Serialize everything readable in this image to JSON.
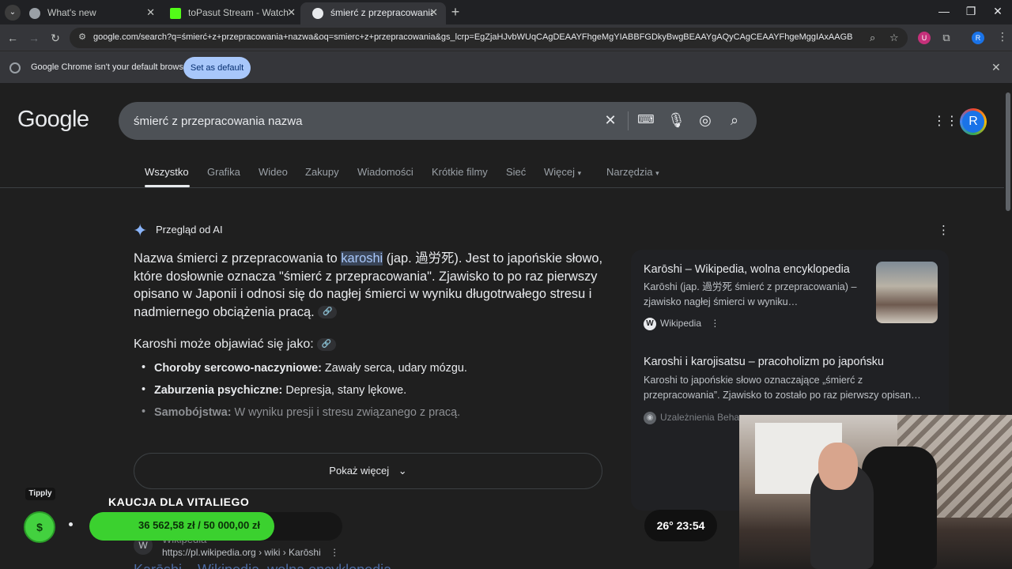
{
  "browser": {
    "tabs": [
      {
        "title": "What's new",
        "favicon_color": "#9aa0a6",
        "active": false
      },
      {
        "title": "toPasut Stream - Watch Live on",
        "favicon_color": "#53fc18",
        "active": false
      },
      {
        "title": "śmierć z przepracowania nazwa",
        "favicon_color": "#e8eaed",
        "active": true
      }
    ],
    "url": "google.com/search?q=śmierć+z+przepracowania+nazwa&oq=smierc+z+przepracowania&gs_lcrp=EgZjaHJvbWUqCAgDEAAYFhgeMgYIABBFGDkyBwgBEAAYgAQyCAgCEAAYFhgeMggIAxAAGBYYHjIICAQQABg...",
    "infobar": {
      "message": "Google Chrome isn't your default browser",
      "button": "Set as default"
    },
    "profile_letter": "R"
  },
  "google": {
    "logo": "Google",
    "query": "śmierć z przepracowania nazwa",
    "avatar_letter": "R",
    "tabs": [
      "Wszystko",
      "Grafika",
      "Wideo",
      "Zakupy",
      "Wiadomości",
      "Krótkie filmy",
      "Sieć",
      "Więcej",
      "Narzędzia"
    ],
    "ai_overview": {
      "label": "Przegląd od AI",
      "para_before": "Nazwa śmierci z przepracowania to ",
      "highlight": "karoshi",
      "para_after": " (jap. 過労死). Jest to japońskie słowo, które dosłownie oznacza \"śmierć z przepracowania\". Zjawisko to po raz pierwszy opisano w Japonii i odnosi się do nagłej śmierci w wyniku długotrwałego stresu i nadmiernego obciążenia pracą.",
      "subheading": "Karoshi może objawiać się jako:",
      "list": [
        {
          "bold": "Choroby sercowo-naczyniowe:",
          "text": " Zawały serca, udary mózgu."
        },
        {
          "bold": "Zaburzenia psychiczne:",
          "text": " Depresja, stany lękowe."
        },
        {
          "bold": "Samobójstwa:",
          "text": " W wyniku presji i stresu związanego z pracą."
        }
      ],
      "show_more": "Pokaż więcej"
    },
    "sources": [
      {
        "title": "Karōshi – Wikipedia, wolna encyklopedia",
        "snippet": "Karōshi (jap. 過労死 śmierć z przepracowania) – zjawisko nagłej śmierci w wyniku…",
        "site": "Wikipedia"
      },
      {
        "title": "Karoshi i karojisatsu – pracoholizm po japońsku",
        "snippet": "Karoshi to japońskie słowo oznaczające „śmierć z przepracowania”. Zjawisko to zostało po raz pierwszy opisan…",
        "site": "Uzależnienia Behaw..."
      }
    ],
    "result": {
      "site": "Wikipedia",
      "url": "https://pl.wikipedia.org › wiki › Karōshi",
      "title": "Karōshi – Wikipedia, wolna encyklopedia"
    }
  },
  "overlay": {
    "tipply": "Tipply",
    "goal_title": "KAUCJA DLA VITALIEGO",
    "goal_text": "36 562,58 zł / 50 000,00 zł",
    "goal_progress": 0.73,
    "clock": "26° 23:54",
    "accent": "#3bd12f"
  }
}
